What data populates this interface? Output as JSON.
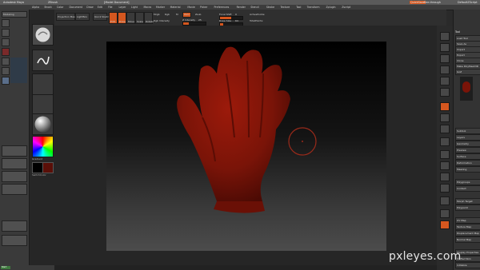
{
  "titlebar": {
    "app_title": "Autodesk Maya",
    "zbrush_title": "ZBrush",
    "doc_label": "[Model Document]"
  },
  "zbrush_menu": [
    "Alpha",
    "Brush",
    "Color",
    "Document",
    "Draw",
    "Edit",
    "File",
    "Layer",
    "Light",
    "Macro",
    "Marker",
    "Material",
    "Movie",
    "Picker",
    "Preferences",
    "Render",
    "Stencil",
    "Stroke",
    "Texture",
    "Tool",
    "Transform",
    "Zplugin",
    "Zscript"
  ],
  "right_title": {
    "quicksave": "QuickSave",
    "see_through": "See-through",
    "menus": "Menus",
    "default_zscript": "DefaultZScript"
  },
  "left_tray": {
    "projection_master": "Projection Master",
    "lightbox": "LightBox",
    "quick_sketch": "Quick Sketch"
  },
  "shelf": {
    "edit": "Edit",
    "draw": "Draw",
    "move": "Move",
    "scale": "Scale",
    "rotate": "Rotate",
    "mrgb": "Mrgb",
    "rgb": "Rgb",
    "m": "M",
    "zadd": "Zadd",
    "zsub": "Zsub",
    "zcut": "Zcut",
    "rgb_intensity": "Rgb Intensity",
    "z_intensity": "Z Intensity",
    "z_intensity_value": "25",
    "focal_shift": "Focal Shift",
    "focal_shift_value": "0",
    "draw_size": "Draw Size",
    "draw_size_value": "64",
    "active_points": "ActivePoints:",
    "total_points": "TotalPoints:"
  },
  "left_labels": {
    "gradient": "Gradient",
    "switch_color": "SwitchColor"
  },
  "right_palette": {
    "header": "Tool",
    "rows": [
      "Load Tool",
      "Save As",
      "Import",
      "Export",
      "Clone",
      "Make PolyMesh3D",
      "GoZ",
      "All",
      "Visible",
      "R"
    ],
    "sections": [
      "Lightbox",
      "Subtool",
      "Layers",
      "Geometry",
      "Preview",
      "Surface",
      "Deformation",
      "Masking",
      "Polygroups",
      "Contact",
      "Morph Target",
      "Polypaint",
      "UV Map",
      "Texture Map",
      "Displacement Map",
      "Normal Map",
      "Display Properties",
      "Unified Skin",
      "Initialize",
      "Import",
      "Export"
    ]
  },
  "maya": {
    "channel_label": "Channel Box",
    "modeling": "Modeling"
  },
  "bottom_taskbar": {
    "start": "Start"
  },
  "colors": {
    "accent": "#d5571f",
    "model": "#7a1408",
    "brush_ring": "#9a2a1a"
  },
  "watermark": "pxleyes.com"
}
